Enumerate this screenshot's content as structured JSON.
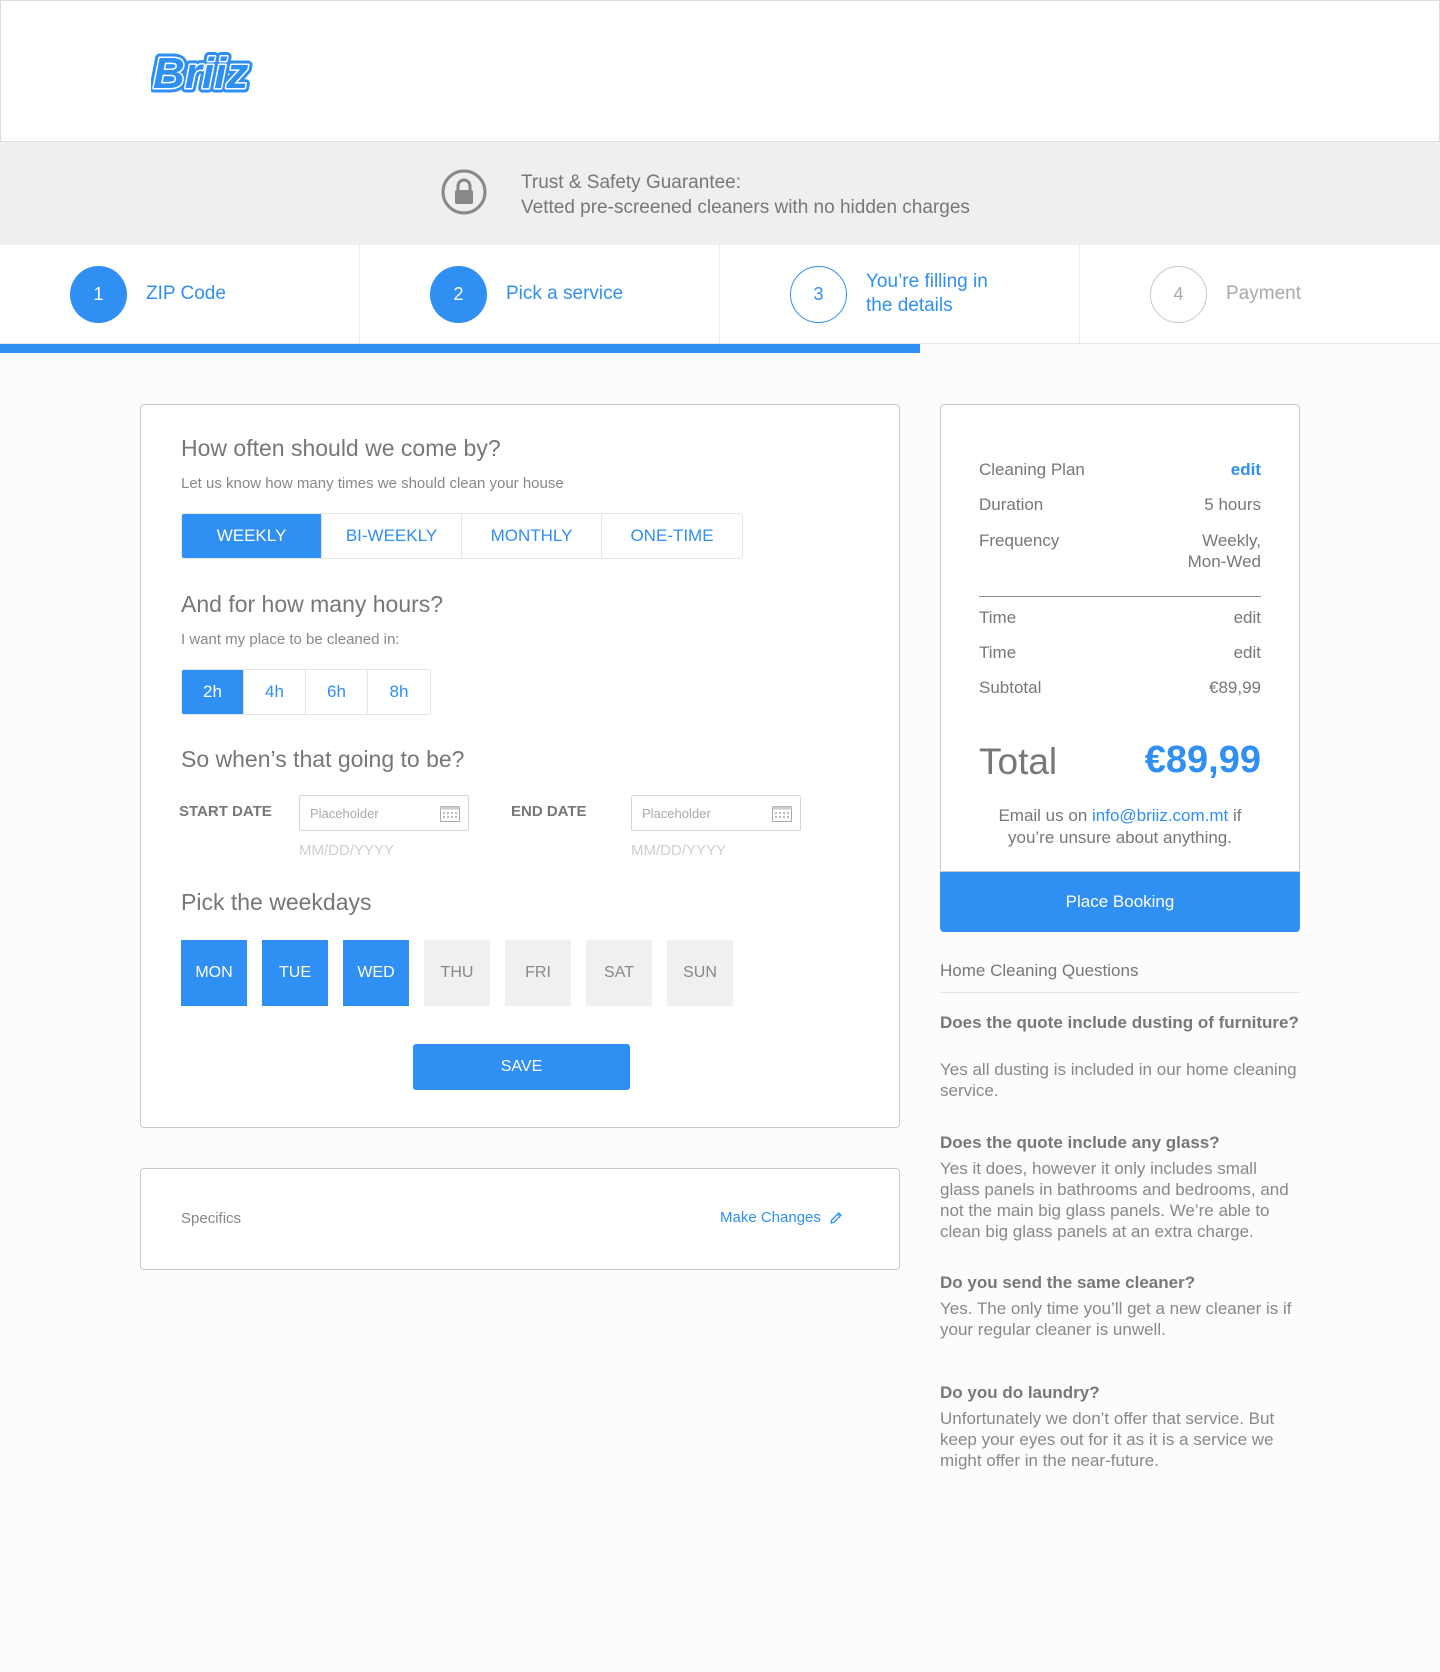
{
  "brand": {
    "name": "Briiz",
    "color": "#2f8ff2"
  },
  "trust": {
    "line1": "Trust & Safety Guarantee:",
    "line2": "Vetted pre-screened cleaners with no hidden charges"
  },
  "steps": [
    {
      "number": "1",
      "label": "ZIP Code",
      "state": "done"
    },
    {
      "number": "2",
      "label": "Pick a service",
      "state": "done"
    },
    {
      "number": "3",
      "label_line1": "You’re filling in",
      "label_line2": "the details",
      "state": "current"
    },
    {
      "number": "4",
      "label": "Payment",
      "state": "todo"
    }
  ],
  "frequency": {
    "title": "How often should we come by?",
    "subtitle": "Let us know how many times we should clean your house",
    "options": [
      "WEEKLY",
      "BI-WEEKLY",
      "MONTHLY",
      "ONE-TIME"
    ],
    "selected": "WEEKLY"
  },
  "hours": {
    "title": "And for how many hours?",
    "subtitle": "I want my place to be cleaned in:",
    "options": [
      "2h",
      "4h",
      "6h",
      "8h"
    ],
    "selected": "2h"
  },
  "dates": {
    "title": "So when’s that going to be?",
    "start_label": "START DATE",
    "end_label": "END DATE",
    "placeholder": "Placeholder",
    "hint": "MM/DD/YYYY"
  },
  "weekdays": {
    "title": "Pick the weekdays",
    "days": [
      "MON",
      "TUE",
      "WED",
      "THU",
      "FRI",
      "SAT",
      "SUN"
    ],
    "selected": [
      "MON",
      "TUE",
      "WED"
    ]
  },
  "save_label": "SAVE",
  "specifics": {
    "label": "Specifics",
    "action": "Make Changes"
  },
  "summary": {
    "plan_label": "Cleaning Plan",
    "plan_action": "edit",
    "duration_label": "Duration",
    "duration_value": "5 hours",
    "frequency_label": "Frequency",
    "frequency_value_line1": "Weekly,",
    "frequency_value_line2": "Mon-Wed",
    "time1_label": "Time",
    "time1_action": "edit",
    "time2_label": "Time",
    "time2_action": "edit",
    "subtotal_label": "Subtotal",
    "subtotal_value": "€89,99",
    "total_label": "Total",
    "total_value": "€89,99",
    "email_prefix": "Email us on ",
    "email_link": "info@briiz.com.mt",
    "email_suffix": " if",
    "email_line2": "you’re  unsure about anything."
  },
  "book_label": "Place Booking",
  "faq": {
    "title": "Home Cleaning Questions",
    "items": [
      {
        "q": "Does the quote include dusting of furniture?",
        "a": "Yes all dusting is included in our home cleaning service."
      },
      {
        "q": "Does the quote include any glass?",
        "a": "Yes it does, however it only includes small glass panels in bathrooms and bedrooms, and not the main big glass panels. We’re able to clean big glass panels at an extra charge."
      },
      {
        "q": "Do you send the same cleaner?",
        "a": "Yes. The only time you’ll get a new cleaner is if your regular cleaner is unwell."
      },
      {
        "q": "Do you do laundry?",
        "a": "Unfortunately we don’t offer that service. But keep your eyes out for it as it is a service we might offer in the near-future."
      }
    ]
  }
}
